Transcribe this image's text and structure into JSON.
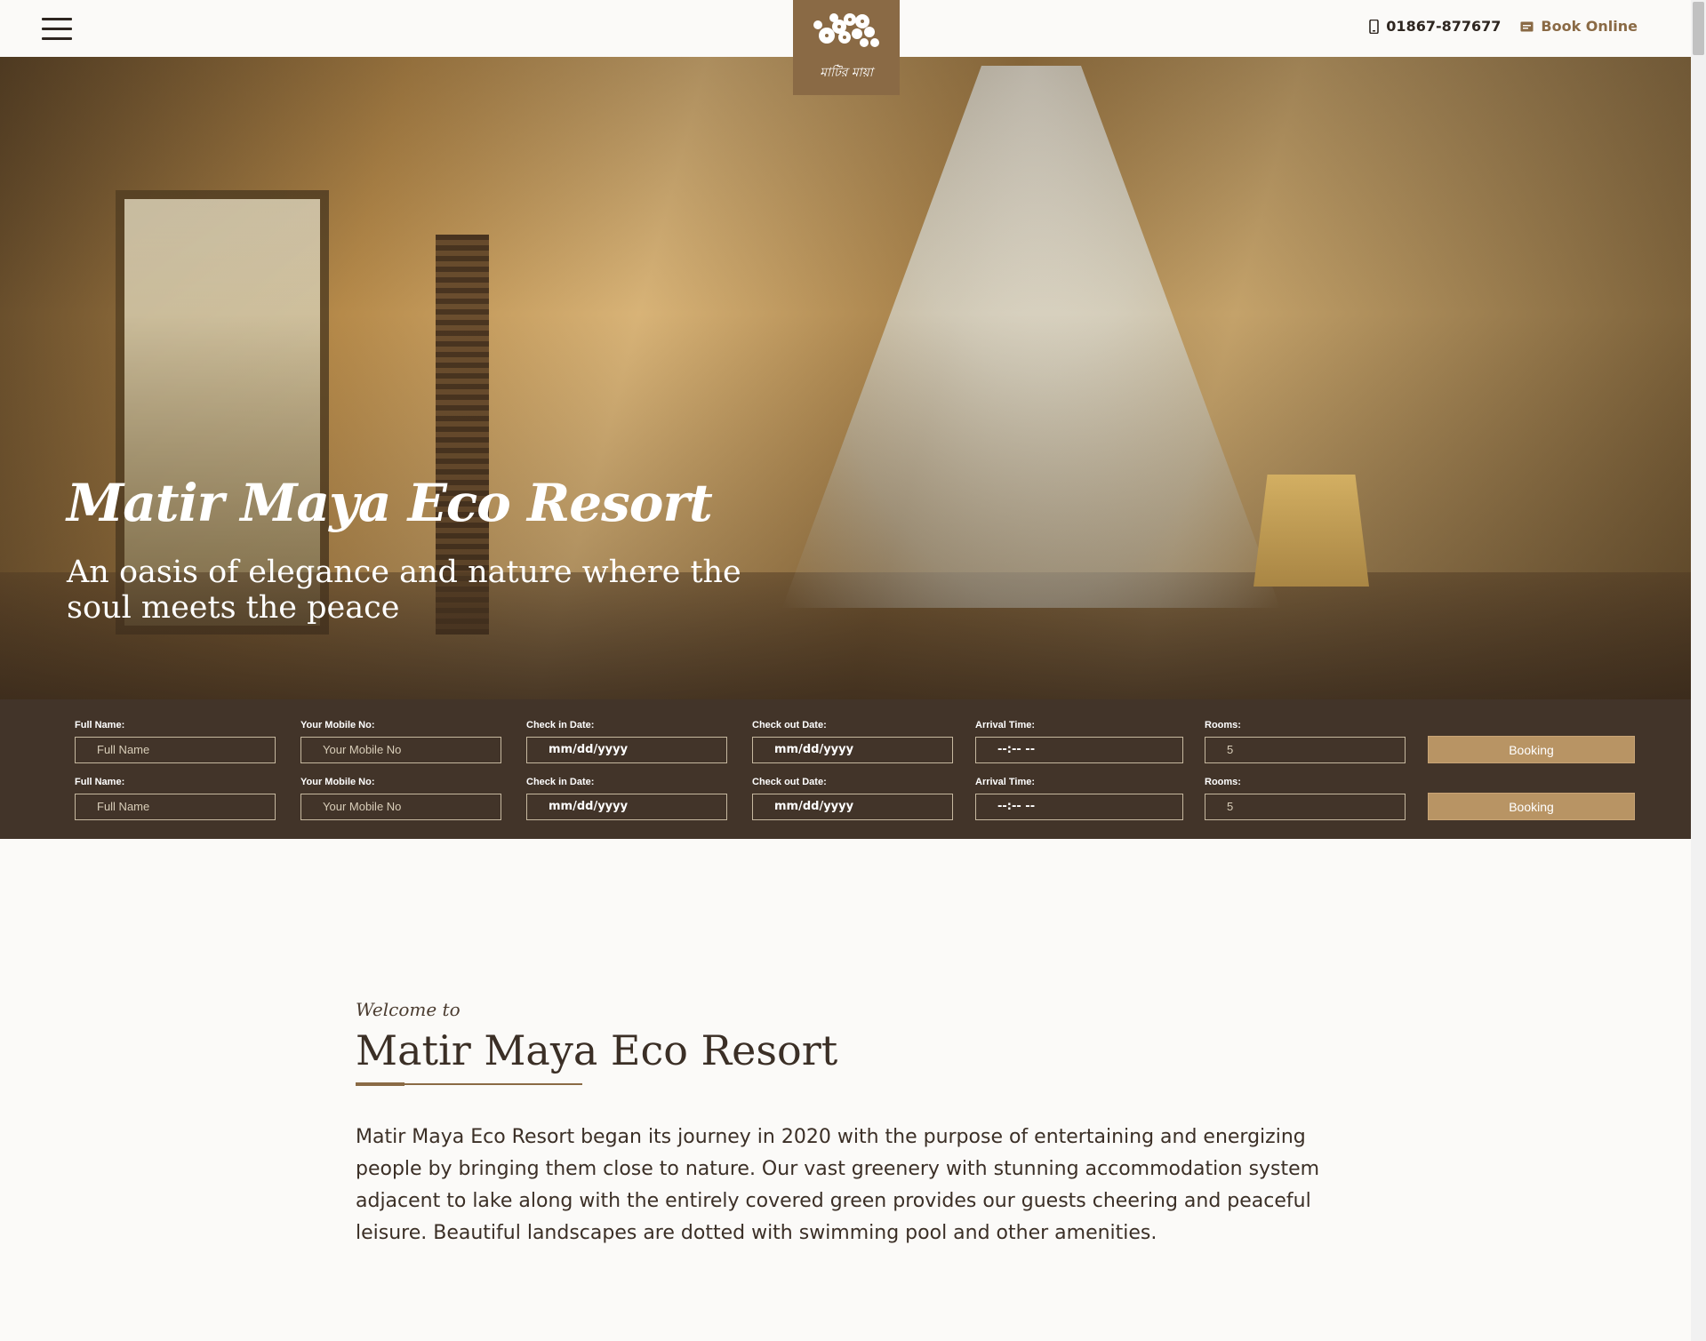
{
  "header": {
    "logo_text": "মাটির মায়া",
    "phone": "01867-877677",
    "book_label": "Book Online"
  },
  "hero": {
    "title": "Matir Maya Eco Resort",
    "subtitle": "An oasis of elegance and nature where the soul meets the peace"
  },
  "booking": {
    "rows": [
      {
        "name_label": "Full Name:",
        "name_placeholder": "Full Name",
        "mobile_label": "Your Mobile No:",
        "mobile_placeholder": "Your Mobile No",
        "checkin_label": "Check in Date:",
        "checkin_value": "mm/dd/yyyy",
        "checkout_label": "Check out Date:",
        "checkout_value": "mm/dd/yyyy",
        "arrival_label": "Arrival Time:",
        "arrival_value": "--:-- --",
        "rooms_label": "Rooms:",
        "rooms_placeholder": "5",
        "button_label": "Booking"
      },
      {
        "name_label": "Full Name:",
        "name_placeholder": "Full Name",
        "mobile_label": "Your Mobile No:",
        "mobile_placeholder": "Your Mobile No",
        "checkin_label": "Check in Date:",
        "checkin_value": "mm/dd/yyyy",
        "checkout_label": "Check out Date:",
        "checkout_value": "mm/dd/yyyy",
        "arrival_label": "Arrival Time:",
        "arrival_value": "--:-- --",
        "rooms_label": "Rooms:",
        "rooms_placeholder": "5",
        "button_label": "Booking"
      }
    ]
  },
  "welcome": {
    "small": "Welcome to",
    "title": "Matir Maya Eco Resort",
    "body": "Matir Maya Eco Resort began its journey in 2020 with the purpose of entertaining and energizing people by bringing them close to nature. Our vast greenery with stunning accommodation system adjacent to lake along with the entirely covered green provides our guests cheering and peaceful leisure. Beautiful landscapes are dotted with swimming pool and other amenities."
  },
  "colors": {
    "brand": "#8a6a45",
    "booking_bg": "#3a2c20",
    "button": "#b89464"
  },
  "icons": [
    "menu-icon",
    "flower-logo-icon",
    "phone-icon",
    "calendar-icon"
  ]
}
